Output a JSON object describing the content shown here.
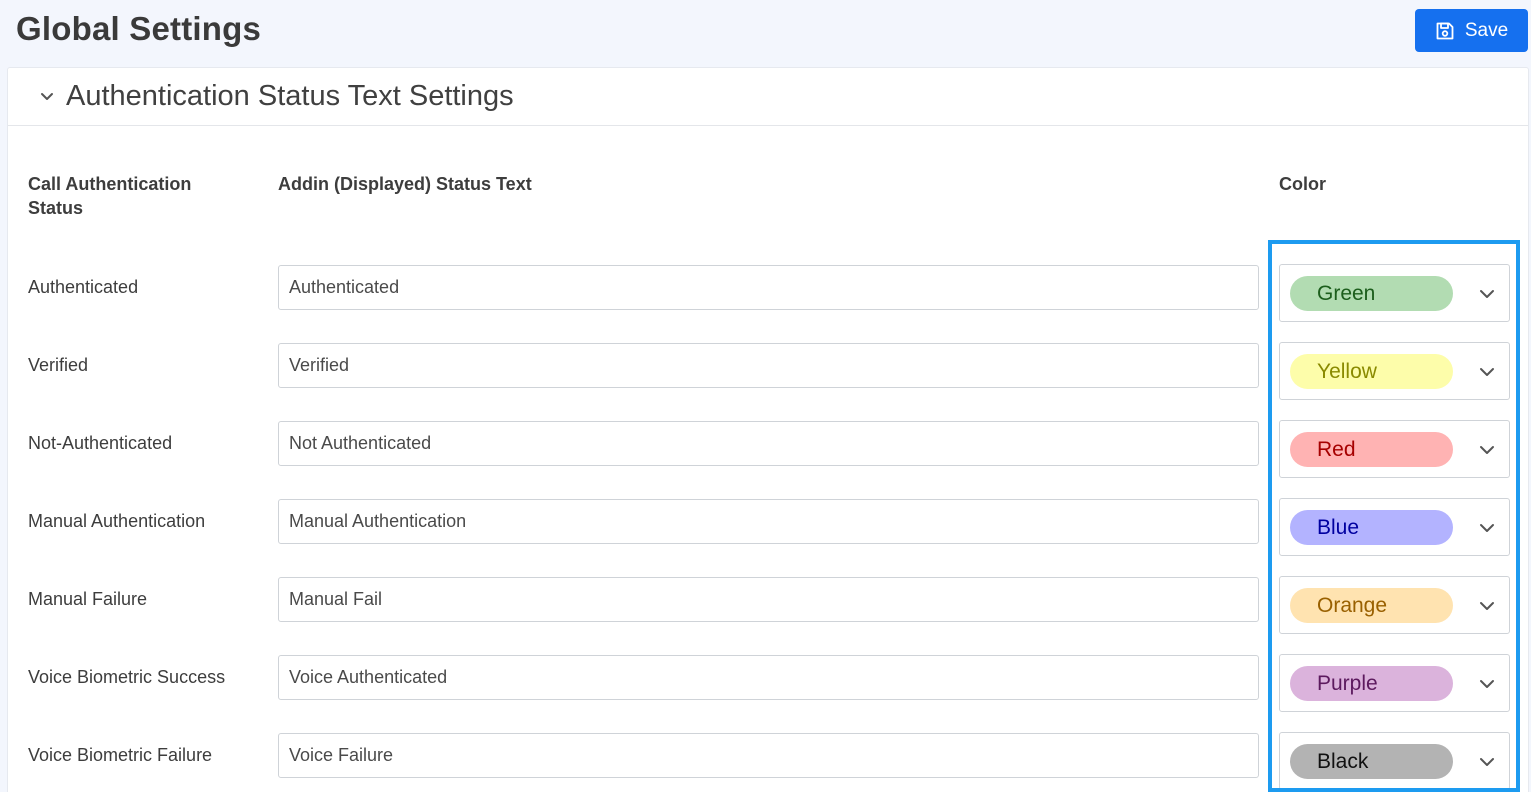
{
  "header": {
    "title": "Global Settings",
    "save_label": "Save"
  },
  "section": {
    "title": "Authentication Status Text Settings",
    "columns": {
      "status": "Call Authentication Status",
      "text": "Addin (Displayed) Status Text",
      "color": "Color"
    },
    "rows": [
      {
        "status": "Authenticated",
        "text": "Authenticated",
        "color": "Green",
        "pill_bg": "#b2dcb2",
        "pill_fg": "#1c5e1c"
      },
      {
        "status": "Verified",
        "text": "Verified",
        "color": "Yellow",
        "pill_bg": "#fdfdaa",
        "pill_fg": "#8a8a00"
      },
      {
        "status": "Not-Authenticated",
        "text": "Not Authenticated",
        "color": "Red",
        "pill_bg": "#ffb3b3",
        "pill_fg": "#a60000"
      },
      {
        "status": "Manual Authentication",
        "text": "Manual Authentication",
        "color": "Blue",
        "pill_bg": "#b3b3ff",
        "pill_fg": "#0000a0"
      },
      {
        "status": "Manual Failure",
        "text": "Manual Fail",
        "color": "Orange",
        "pill_bg": "#ffe3b0",
        "pill_fg": "#996000"
      },
      {
        "status": "Voice Biometric Success",
        "text": "Voice Authenticated",
        "color": "Purple",
        "pill_bg": "#dbb3dc",
        "pill_fg": "#5c1a5e"
      },
      {
        "status": "Voice Biometric Failure",
        "text": "Voice Failure",
        "color": "Black",
        "pill_bg": "#b3b3b3",
        "pill_fg": "#111111"
      }
    ]
  },
  "colors": {
    "accent": "#1570ef",
    "highlight": "#1d9bf0"
  },
  "icons": {
    "save": "save-icon",
    "collapse": "chevron-down-icon",
    "select": "chevron-down-icon"
  }
}
